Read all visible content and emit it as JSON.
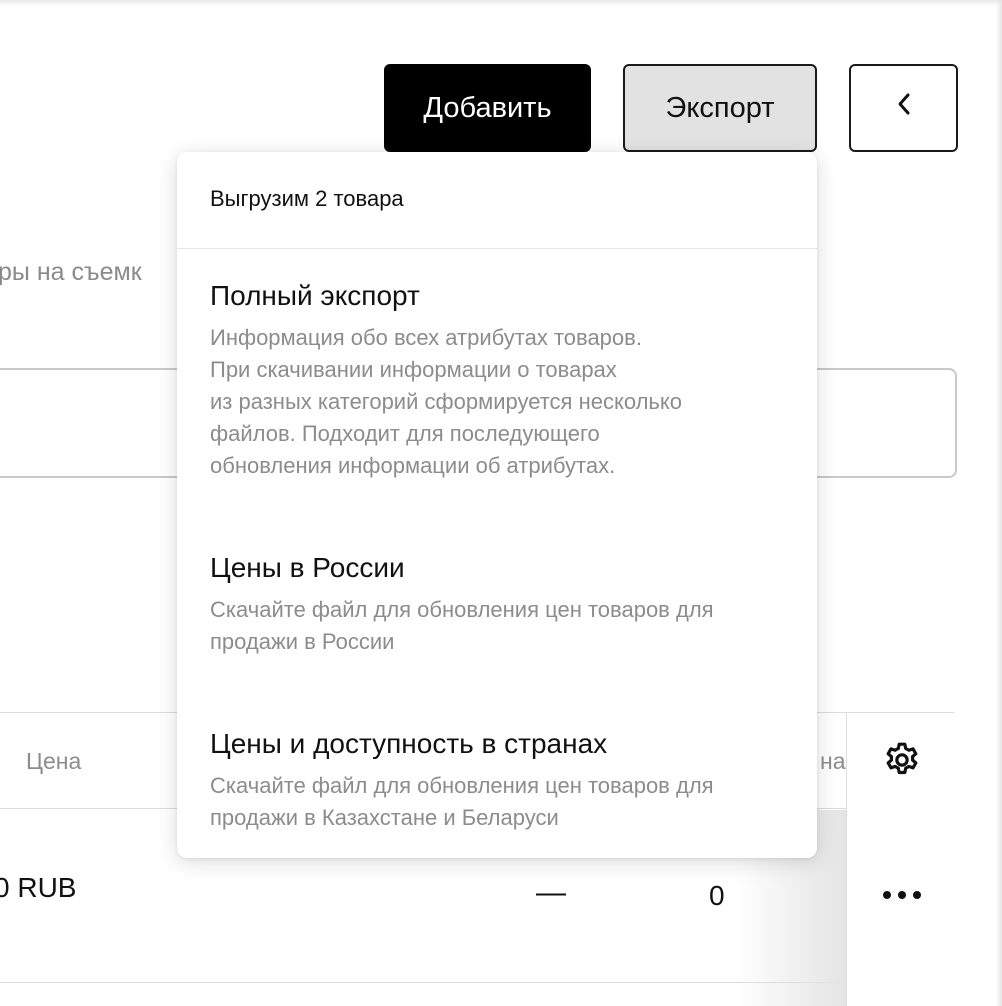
{
  "toolbar": {
    "add_label": "Добавить",
    "export_label": "Экспорт",
    "back_icon": "chevron-left-icon"
  },
  "background": {
    "hint_text": "ры на съемк"
  },
  "table": {
    "columns": {
      "price": "Цена",
      "partial": "на"
    },
    "row": {
      "price": "0 RUB",
      "dash": "—",
      "count": "0"
    },
    "settings_icon": "gear-icon",
    "row_actions_icon": "more-dots-icon"
  },
  "export_menu": {
    "header": "Выгрузим 2 товара",
    "items": [
      {
        "title": "Полный экспорт",
        "description": "Информация обо всех атрибутах товаров.\nПри скачивании информации о товарах\nиз разных категорий сформируется несколько\nфайлов. Подходит для последующего\nобновления информации об атрибутах."
      },
      {
        "title": "Цены в России",
        "description": "Скачайте файл для обновления цен товаров для\nпродажи в России"
      },
      {
        "title": "Цены и доступность в странах",
        "description": "Скачайте файл для обновления цен товаров для\nпродажи в Казахстане и Беларуси"
      }
    ]
  },
  "colors": {
    "primary_button": "#000000",
    "export_button": "#e2e2e2",
    "muted_text": "#8c8c8c"
  }
}
